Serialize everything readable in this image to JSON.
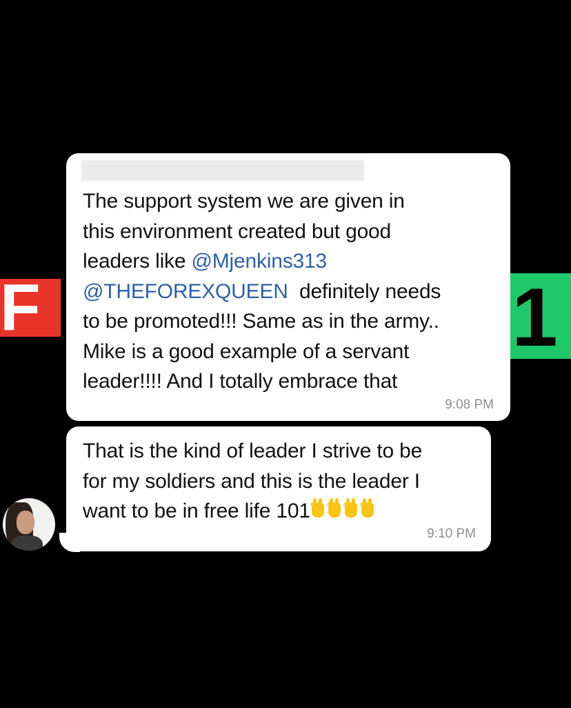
{
  "background": {
    "left_logo_text": "F",
    "right_logo_text": "1",
    "left_color": "#e8342b",
    "right_color": "#1ec86a"
  },
  "messages": [
    {
      "lines": [
        [
          "The support system we are given in"
        ],
        [
          "this environment created but good"
        ],
        [
          "leaders like ",
          {
            "mention": "@Mjenkins313"
          }
        ],
        [
          {
            "mention": "@THEFOREXQUEEN"
          },
          "  definitely needs"
        ],
        [
          "to be promoted!!! Same as in the army.."
        ],
        [
          "Mike is a good example of a servant"
        ],
        [
          "leader!!!! And I totally embrace that"
        ]
      ],
      "time": "9:08 PM"
    },
    {
      "lines": [
        [
          "That is the kind of leader I strive to be"
        ],
        [
          "for my soldiers and this is the leader I"
        ],
        [
          "want to be in free life 101"
        ]
      ],
      "emoji": "raising-hands-icon",
      "emoji_count": 4,
      "time": "9:10 PM"
    }
  ],
  "colors": {
    "mention": "#2f5fa3",
    "bubble": "#ffffff",
    "timestamp": "#8e8e93"
  }
}
